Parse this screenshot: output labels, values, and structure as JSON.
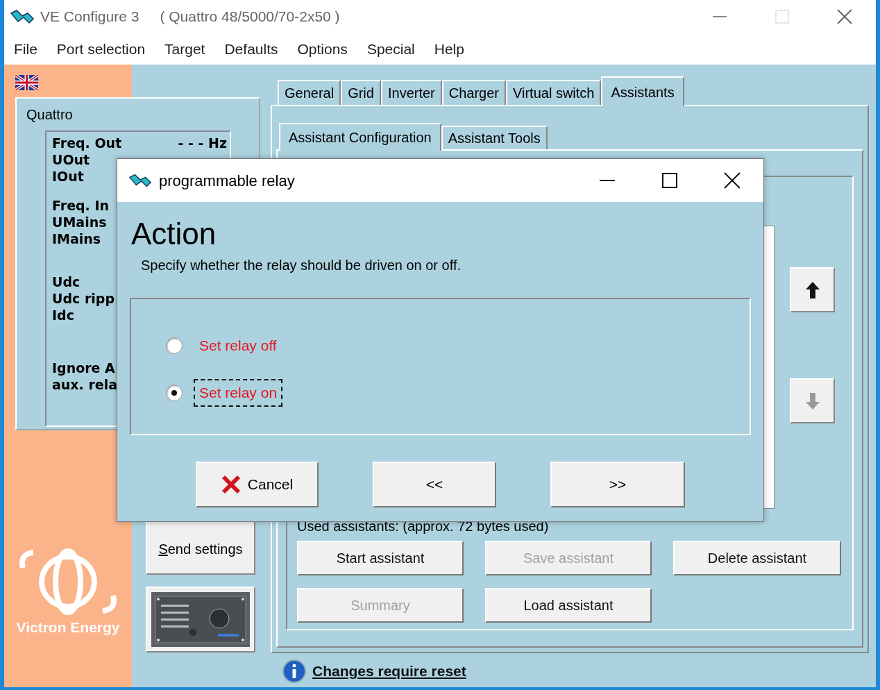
{
  "window": {
    "title": "VE Configure 3",
    "subtitle": "( Quattro 48/5000/70-2x50 )"
  },
  "menu": [
    "File",
    "Port selection",
    "Target",
    "Defaults",
    "Options",
    "Special",
    "Help"
  ],
  "device_panel": {
    "title": "Quattro",
    "reading_groups": [
      {
        "items": [
          {
            "label": "Freq. Out",
            "value": "- - - Hz"
          },
          {
            "label": "UOut"
          },
          {
            "label": "IOut"
          }
        ]
      },
      {
        "items": [
          {
            "label": "Freq. In"
          },
          {
            "label": "UMains"
          },
          {
            "label": "IMains"
          }
        ]
      },
      {
        "items": [
          {
            "label": "Udc"
          },
          {
            "label": "Udc ripp"
          },
          {
            "label": "Idc"
          }
        ]
      },
      {
        "items": [
          {
            "label": "Ignore A"
          },
          {
            "label": "aux. rela"
          }
        ]
      }
    ]
  },
  "send_button": {
    "label": "Send settings",
    "first_letter_underlined": true
  },
  "logo_text": "Victron Energy",
  "tabs": [
    {
      "label": "General",
      "selected": false
    },
    {
      "label": "Grid",
      "selected": false
    },
    {
      "label": "Inverter",
      "selected": false
    },
    {
      "label": "Charger",
      "selected": false
    },
    {
      "label": "Virtual switch",
      "selected": false
    },
    {
      "label": "Assistants",
      "selected": true
    }
  ],
  "subtabs": [
    {
      "label": "Assistant Configuration",
      "selected": true
    },
    {
      "label": "Assistant Tools",
      "selected": false
    }
  ],
  "move_buttons": [
    {
      "kind": "up",
      "disabled": false
    },
    {
      "kind": "down",
      "disabled": true
    }
  ],
  "used_assistants": "Used assistants: (approx. 72 bytes used)",
  "assistant_buttons": [
    {
      "label": "Start assistant",
      "disabled": false
    },
    {
      "label": "Save assistant",
      "disabled": true
    },
    {
      "label": "Delete assistant",
      "disabled": false
    },
    {
      "label": "Summary",
      "disabled": true
    },
    {
      "label": "Load assistant",
      "disabled": false
    }
  ],
  "footer_link": "Changes require reset",
  "dialog": {
    "title": "programmable relay",
    "heading": "Action",
    "description": "Specify whether the relay should be driven on or off.",
    "options": [
      {
        "label": "Set relay off",
        "selected": false,
        "focused": false
      },
      {
        "label": "Set relay on",
        "selected": true,
        "focused": true
      }
    ],
    "buttons": [
      {
        "kind": "cancel",
        "label": "Cancel"
      },
      {
        "kind": "back",
        "label": "<<"
      },
      {
        "kind": "next",
        "label": ">>"
      }
    ]
  }
}
